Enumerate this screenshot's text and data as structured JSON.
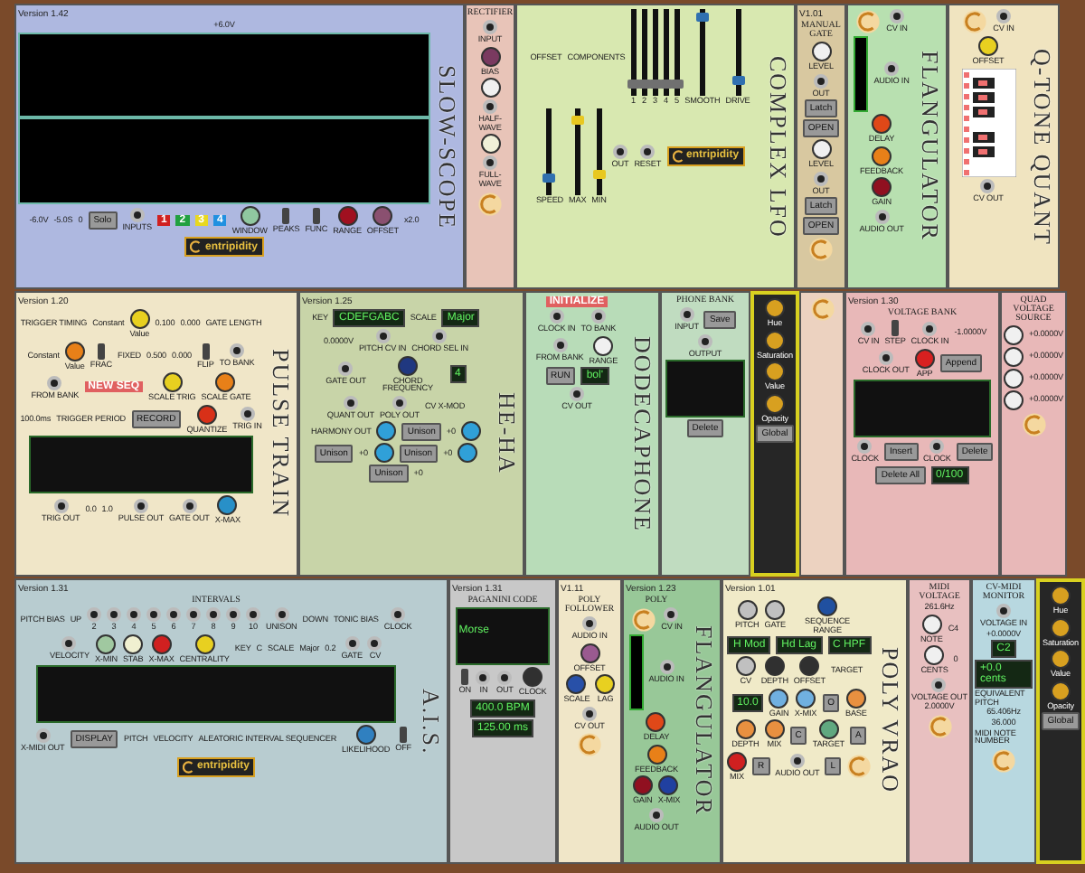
{
  "racks": [
    {
      "modules": [
        {
          "color": "#aeb8e0",
          "version": "Version 1.42",
          "side_title": "SLOW-SCOPE",
          "controls": [
            {
              "kind": "text",
              "label": "+6.0V"
            },
            {
              "kind": "scope_screen"
            },
            {
              "kind": "text",
              "label": "-6.0V"
            },
            {
              "kind": "text",
              "label": "-5.0S"
            },
            {
              "kind": "text",
              "label": "0"
            },
            {
              "kind": "button",
              "label": "Solo"
            },
            {
              "kind": "jack",
              "label": "INPUTS"
            },
            {
              "kind": "tag",
              "label": "1",
              "color": "#d02020"
            },
            {
              "kind": "tag",
              "label": "2",
              "color": "#20a040"
            },
            {
              "kind": "tag",
              "label": "3",
              "color": "#e8d820"
            },
            {
              "kind": "tag",
              "label": "4",
              "color": "#2090e0"
            },
            {
              "kind": "knob",
              "label": "WINDOW",
              "color": "#90c8a0"
            },
            {
              "kind": "switch",
              "label": "PEAKS"
            },
            {
              "kind": "switch",
              "label": "FUNC"
            },
            {
              "kind": "knob",
              "label": "RANGE",
              "color": "#a01020"
            },
            {
              "kind": "knob",
              "label": "OFFSET",
              "color": "#8a5070"
            },
            {
              "kind": "text",
              "label": "x2.0"
            },
            {
              "kind": "logo",
              "label": "entripidity"
            }
          ]
        },
        {
          "color": "#e8c4b8",
          "title": "RECTIFIER",
          "controls": [
            {
              "kind": "jack",
              "label": "INPUT"
            },
            {
              "kind": "knob",
              "label": "BIAS",
              "color": "#7a3a60"
            },
            {
              "kind": "knob",
              "color": "#f0f0f0"
            },
            {
              "kind": "jack",
              "label": "HALF-WAVE"
            },
            {
              "kind": "knob",
              "color": "#f0f0d8"
            },
            {
              "kind": "jack",
              "label": "FULL-WAVE"
            },
            {
              "kind": "clogo"
            }
          ]
        },
        {
          "color": "#d8e8b0",
          "side_title": "COMPLEX LFO",
          "controls": [
            {
              "kind": "text",
              "label": "OFFSET"
            },
            {
              "kind": "text",
              "label": "COMPONENTS"
            },
            {
              "kind": "slider",
              "label": "1",
              "level": 0.1,
              "color": "#707070"
            },
            {
              "kind": "slider",
              "label": "2",
              "level": 0.1,
              "color": "#707070"
            },
            {
              "kind": "slider",
              "label": "3",
              "level": 0.1,
              "color": "#707070"
            },
            {
              "kind": "slider",
              "label": "4",
              "level": 0.1,
              "color": "#707070"
            },
            {
              "kind": "slider",
              "label": "5",
              "level": 0.1,
              "color": "#707070"
            },
            {
              "kind": "slider",
              "label": "SMOOTH",
              "level": 0.95,
              "color": "#3070b0"
            },
            {
              "kind": "slider",
              "label": "DRIVE",
              "level": 0.15,
              "color": "#3070b0"
            },
            {
              "kind": "slider",
              "label": "SPEED",
              "level": 0.15,
              "color": "#3070b0"
            },
            {
              "kind": "slider",
              "label": "MAX",
              "level": 0.9,
              "color": "#e8c820"
            },
            {
              "kind": "slider",
              "label": "MIN",
              "level": 0.2,
              "color": "#e8c820"
            },
            {
              "kind": "jack",
              "label": "OUT"
            },
            {
              "kind": "jack",
              "label": "RESET"
            },
            {
              "kind": "logo",
              "label": "entripidity"
            }
          ]
        },
        {
          "color": "#d8c8a0",
          "title": "MANUAL GATE",
          "version": "V1.01",
          "controls": [
            {
              "kind": "knob",
              "label": "LEVEL",
              "color": "#f0f0f0"
            },
            {
              "kind": "jack",
              "label": "OUT"
            },
            {
              "kind": "button",
              "label": "Latch"
            },
            {
              "kind": "button",
              "label": "OPEN"
            },
            {
              "kind": "knob",
              "label": "LEVEL",
              "color": "#f0f0f0"
            },
            {
              "kind": "jack",
              "label": "OUT"
            },
            {
              "kind": "button",
              "label": "Latch"
            },
            {
              "kind": "button",
              "label": "OPEN"
            },
            {
              "kind": "clogo"
            }
          ]
        },
        {
          "color": "#b8e0b0",
          "side_title": "FLANGULATOR",
          "controls": [
            {
              "kind": "clogo"
            },
            {
              "kind": "jack",
              "label": "CV IN"
            },
            {
              "kind": "meter"
            },
            {
              "kind": "jack",
              "label": "AUDIO IN"
            },
            {
              "kind": "knob",
              "label": "DELAY",
              "color": "#e04818"
            },
            {
              "kind": "knob",
              "label": "FEEDBACK",
              "color": "#e88018"
            },
            {
              "kind": "knob",
              "label": "GAIN",
              "color": "#901020"
            },
            {
              "kind": "jack",
              "label": "AUDIO OUT"
            }
          ]
        },
        {
          "color": "#f0e4c0",
          "side_title": "Q-TONE QUANT",
          "controls": [
            {
              "kind": "clogo"
            },
            {
              "kind": "jack",
              "label": "CV IN"
            },
            {
              "kind": "knob",
              "label": "OFFSET",
              "color": "#e8d020"
            },
            {
              "kind": "keyboard"
            },
            {
              "kind": "jack",
              "label": "CV OUT"
            }
          ]
        }
      ]
    },
    {
      "modules": [
        {
          "color": "#f0e6c8",
          "version": "Version 1.20",
          "side_title": "PULSE TRAIN",
          "controls": [
            {
              "kind": "text",
              "label": "TRIGGER TIMING"
            },
            {
              "kind": "text",
              "label": "Constant"
            },
            {
              "kind": "knob",
              "label": "Value",
              "color": "#e8d020"
            },
            {
              "kind": "text",
              "label": "0.100"
            },
            {
              "kind": "text",
              "label": "0.000"
            },
            {
              "kind": "text",
              "label": "GATE LENGTH"
            },
            {
              "kind": "text",
              "label": "Constant"
            },
            {
              "kind": "knob",
              "label": "Value",
              "color": "#e88018"
            },
            {
              "kind": "switch",
              "label": "FRAC"
            },
            {
              "kind": "text",
              "label": "FIXED"
            },
            {
              "kind": "text",
              "label": "0.500"
            },
            {
              "kind": "text",
              "label": "0.000"
            },
            {
              "kind": "switch",
              "label": "FLIP"
            },
            {
              "kind": "jack",
              "label": "TO BANK"
            },
            {
              "kind": "jack",
              "label": "FROM BANK"
            },
            {
              "kind": "tag",
              "label": "NEW SEQ",
              "color": "#e06060"
            },
            {
              "kind": "knob",
              "label": "SCALE TRIG",
              "color": "#e8d020"
            },
            {
              "kind": "knob",
              "label": "SCALE GATE",
              "color": "#e88018"
            },
            {
              "kind": "text",
              "label": "100.0ms"
            },
            {
              "kind": "text",
              "label": "TRIGGER PERIOD"
            },
            {
              "kind": "button",
              "label": "RECORD"
            },
            {
              "kind": "knob",
              "label": "QUANTIZE",
              "color": "#d83018"
            },
            {
              "kind": "jack",
              "label": "TRIG IN"
            },
            {
              "kind": "screen"
            },
            {
              "kind": "jack",
              "label": "TRIG OUT"
            },
            {
              "kind": "text",
              "label": "0.0"
            },
            {
              "kind": "text",
              "label": "1.0"
            },
            {
              "kind": "jack",
              "label": "PULSE OUT"
            },
            {
              "kind": "jack",
              "label": "GATE OUT"
            },
            {
              "kind": "knob",
              "label": "X-MAX",
              "color": "#2890c8"
            }
          ]
        },
        {
          "color": "#c8d4a8",
          "version": "Version 1.25",
          "side_title": "HE-HA",
          "controls": [
            {
              "kind": "text",
              "label": "KEY"
            },
            {
              "kind": "lcd",
              "label": "CDEFGABC"
            },
            {
              "kind": "text",
              "label": "SCALE"
            },
            {
              "kind": "lcd",
              "label": "Major"
            },
            {
              "kind": "text",
              "label": "0.0000V"
            },
            {
              "kind": "jack",
              "label": "PITCH CV IN"
            },
            {
              "kind": "jack",
              "label": "CHORD SEL IN"
            },
            {
              "kind": "jack",
              "label": "GATE OUT"
            },
            {
              "kind": "knob",
              "label": "CHORD FREQUENCY",
              "color": "#203880"
            },
            {
              "kind": "lcd",
              "label": "4"
            },
            {
              "kind": "jack",
              "label": "QUANT OUT"
            },
            {
              "kind": "jack",
              "label": "POLY OUT"
            },
            {
              "kind": "text",
              "label": "CV X-MOD"
            },
            {
              "kind": "text",
              "label": "HARMONY OUT"
            },
            {
              "kind": "knob",
              "color": "#30a0d8"
            },
            {
              "kind": "button",
              "label": "Unison"
            },
            {
              "kind": "text",
              "label": "+0"
            },
            {
              "kind": "knob",
              "color": "#30a0d8"
            },
            {
              "kind": "button",
              "label": "Unison"
            },
            {
              "kind": "text",
              "label": "+0"
            },
            {
              "kind": "knob",
              "color": "#30a0d8"
            },
            {
              "kind": "button",
              "label": "Unison"
            },
            {
              "kind": "text",
              "label": "+0"
            },
            {
              "kind": "knob",
              "color": "#30a0d8"
            },
            {
              "kind": "button",
              "label": "Unison"
            },
            {
              "kind": "text",
              "label": "+0"
            }
          ]
        },
        {
          "color": "#b8dcb8",
          "side_title": "DODECAPHONE",
          "controls": [
            {
              "kind": "tag",
              "label": "INITIALIZE",
              "color": "#e06060"
            },
            {
              "kind": "jack",
              "label": "CLOCK IN"
            },
            {
              "kind": "jack",
              "label": "TO BANK"
            },
            {
              "kind": "jack",
              "label": "FROM BANK"
            },
            {
              "kind": "knob",
              "label": "RANGE",
              "color": "#f0f0f0"
            },
            {
              "kind": "button",
              "label": "RUN"
            },
            {
              "kind": "lcd",
              "label": "bol'"
            },
            {
              "kind": "jack",
              "label": "CV OUT"
            }
          ]
        },
        {
          "color": "#c0dcc0",
          "title": "PHONE BANK",
          "controls": [
            {
              "kind": "jack",
              "label": "INPUT"
            },
            {
              "kind": "button",
              "label": "Save"
            },
            {
              "kind": "jack",
              "label": "OUTPUT"
            },
            {
              "kind": "screen"
            },
            {
              "kind": "button",
              "label": "Delete"
            }
          ]
        },
        {
          "color": "#262626",
          "dark": true,
          "controls": [
            {
              "kind": "knob",
              "label": "Hue",
              "color": "#d8a020"
            },
            {
              "kind": "knob",
              "label": "Saturation",
              "color": "#d8a020"
            },
            {
              "kind": "knob",
              "label": "Value",
              "color": "#d8a020"
            },
            {
              "kind": "knob",
              "label": "Opacity",
              "color": "#d8a020"
            },
            {
              "kind": "button",
              "label": "Global"
            }
          ]
        },
        {
          "color": "#ecd2c0",
          "controls": [
            {
              "kind": "clogo"
            }
          ]
        },
        {
          "color": "#e8b8b8",
          "title": "VOLTAGE BANK",
          "version": "Version 1.30",
          "controls": [
            {
              "kind": "jack",
              "label": "CV IN"
            },
            {
              "kind": "switch",
              "label": "STEP"
            },
            {
              "kind": "jack",
              "label": "CLOCK IN"
            },
            {
              "kind": "text",
              "label": "-1.0000V"
            },
            {
              "kind": "jack",
              "label": "CLOCK OUT"
            },
            {
              "kind": "knob",
              "label": "APP",
              "color": "#d82020"
            },
            {
              "kind": "button",
              "label": "Append"
            },
            {
              "kind": "screen"
            },
            {
              "kind": "jack",
              "label": "CLOCK"
            },
            {
              "kind": "button",
              "label": "Insert"
            },
            {
              "kind": "jack",
              "label": "CLOCK"
            },
            {
              "kind": "button",
              "label": "Delete"
            },
            {
              "kind": "button",
              "label": "Delete All"
            },
            {
              "kind": "lcd",
              "label": "0/100"
            }
          ]
        },
        {
          "color": "#e8b8b8",
          "title": "QUAD VOLTAGE SOURCE",
          "controls": [
            {
              "kind": "knob",
              "color": "#f0f0f0"
            },
            {
              "kind": "text",
              "label": "+0.0000V"
            },
            {
              "kind": "knob",
              "color": "#f0f0f0"
            },
            {
              "kind": "text",
              "label": "+0.0000V"
            },
            {
              "kind": "knob",
              "color": "#f0f0f0"
            },
            {
              "kind": "text",
              "label": "+0.0000V"
            },
            {
              "kind": "knob",
              "color": "#f0f0f0"
            },
            {
              "kind": "text",
              "label": "+0.0000V"
            },
            {
              "kind": "clogo"
            }
          ]
        }
      ]
    },
    {
      "modules": [
        {
          "color": "#b8ccd0",
          "title": "INTERVALS",
          "version": "Version 1.31",
          "side_title": "A.I.S.",
          "controls": [
            {
              "kind": "text",
              "label": "PITCH BIAS"
            },
            {
              "kind": "text",
              "label": "UP"
            },
            {
              "kind": "jack",
              "label": "2"
            },
            {
              "kind": "jack",
              "label": "3"
            },
            {
              "kind": "jack",
              "label": "4"
            },
            {
              "kind": "jack",
              "label": "5"
            },
            {
              "kind": "jack",
              "label": "6"
            },
            {
              "kind": "jack",
              "label": "7"
            },
            {
              "kind": "jack",
              "label": "8"
            },
            {
              "kind": "jack",
              "label": "9"
            },
            {
              "kind": "jack",
              "label": "10"
            },
            {
              "kind": "jack",
              "label": "UNISON"
            },
            {
              "kind": "text",
              "label": "DOWN"
            },
            {
              "kind": "text",
              "label": "TONIC BIAS"
            },
            {
              "kind": "jack",
              "label": "CLOCK"
            },
            {
              "kind": "jack",
              "label": "VELOCITY"
            },
            {
              "kind": "knob",
              "label": "X-MIN",
              "color": "#a0c8a0"
            },
            {
              "kind": "knob",
              "label": "STAB",
              "color": "#f0f0d0"
            },
            {
              "kind": "knob",
              "label": "X-MAX",
              "color": "#d02020"
            },
            {
              "kind": "knob",
              "label": "CENTRALITY",
              "color": "#e8d020"
            },
            {
              "kind": "text",
              "label": "KEY"
            },
            {
              "kind": "text",
              "label": "C"
            },
            {
              "kind": "text",
              "label": "SCALE"
            },
            {
              "kind": "text",
              "label": "Major"
            },
            {
              "kind": "text",
              "label": "0.2"
            },
            {
              "kind": "jack",
              "label": "GATE"
            },
            {
              "kind": "jack",
              "label": "CV"
            },
            {
              "kind": "screen"
            },
            {
              "kind": "jack",
              "label": "X-MIDI OUT"
            },
            {
              "kind": "button",
              "label": "DISPLAY"
            },
            {
              "kind": "text",
              "label": "PITCH"
            },
            {
              "kind": "text",
              "label": "VELOCITY"
            },
            {
              "kind": "text",
              "label": "ALEATORIC INTERVAL SEQUENCER"
            },
            {
              "kind": "knob",
              "label": "LIKELIHOOD",
              "color": "#3080c0"
            },
            {
              "kind": "switch",
              "label": "OFF"
            },
            {
              "kind": "logo",
              "label": "entripidity"
            }
          ]
        },
        {
          "color": "#c8c8c8",
          "title": "PAGANINI CODE",
          "version": "Version 1.31",
          "controls": [
            {
              "kind": "screen",
              "label": "Morse"
            },
            {
              "kind": "switch",
              "label": "ON"
            },
            {
              "kind": "jack",
              "label": "IN"
            },
            {
              "kind": "jack",
              "label": "OUT"
            },
            {
              "kind": "knob",
              "label": "CLOCK",
              "color": "#303030"
            },
            {
              "kind": "lcd",
              "label": "400.0 BPM"
            },
            {
              "kind": "lcd",
              "label": "125.00 ms"
            }
          ]
        },
        {
          "color": "#f0e6c8",
          "title": "POLY FOLLOWER",
          "version": "V1.11",
          "controls": [
            {
              "kind": "jack",
              "label": "AUDIO IN"
            },
            {
              "kind": "knob",
              "label": "OFFSET",
              "color": "#9a5a90"
            },
            {
              "kind": "knob",
              "label": "SCALE",
              "color": "#2850a8"
            },
            {
              "kind": "knob",
              "label": "LAG",
              "color": "#e8d020"
            },
            {
              "kind": "jack",
              "label": "CV OUT"
            },
            {
              "kind": "clogo"
            }
          ]
        },
        {
          "color": "#98c898",
          "title": "POLY",
          "version": "Version 1.23",
          "side_title": "FLANGULATOR",
          "controls": [
            {
              "kind": "clogo"
            },
            {
              "kind": "jack",
              "label": "CV IN"
            },
            {
              "kind": "meter"
            },
            {
              "kind": "jack",
              "label": "AUDIO IN"
            },
            {
              "kind": "knob",
              "label": "DELAY",
              "color": "#e04818"
            },
            {
              "kind": "knob",
              "label": "FEEDBACK",
              "color": "#e88018"
            },
            {
              "kind": "knob",
              "label": "GAIN",
              "color": "#901020"
            },
            {
              "kind": "knob",
              "label": "X-MIX",
              "color": "#2040a0"
            },
            {
              "kind": "jack",
              "label": "AUDIO OUT"
            }
          ]
        },
        {
          "color": "#f0eac8",
          "version": "Version 1.01",
          "side_title": "POLY VRAO",
          "controls": [
            {
              "kind": "knob",
              "label": "PITCH",
              "color": "#c0c0c0"
            },
            {
              "kind": "knob",
              "label": "GATE",
              "color": "#c0c0c0"
            },
            {
              "kind": "knob",
              "label": "SEQUENCE RANGE",
              "color": "#2050a0"
            },
            {
              "kind": "lcd",
              "label": "H Mod"
            },
            {
              "kind": "lcd",
              "label": "Hd Lag"
            },
            {
              "kind": "lcd",
              "label": "C HPF"
            },
            {
              "kind": "knob",
              "label": "CV",
              "color": "#c0c0c0"
            },
            {
              "kind": "knob",
              "label": "DEPTH",
              "color": "#303030"
            },
            {
              "kind": "knob",
              "label": "OFFSET",
              "color": "#303030"
            },
            {
              "kind": "text",
              "label": "TARGET"
            },
            {
              "kind": "lcd",
              "label": "10.0"
            },
            {
              "kind": "knob",
              "label": "GAIN",
              "color": "#70b0e0"
            },
            {
              "kind": "knob",
              "label": "X-MIX",
              "color": "#70b0e0"
            },
            {
              "kind": "button",
              "label": "O"
            },
            {
              "kind": "knob",
              "label": "BASE",
              "color": "#e89040"
            },
            {
              "kind": "knob",
              "label": "DEPTH",
              "color": "#e89040"
            },
            {
              "kind": "knob",
              "label": "MIX",
              "color": "#e89040"
            },
            {
              "kind": "button",
              "label": "C"
            },
            {
              "kind": "knob",
              "label": "TARGET",
              "color": "#60a880"
            },
            {
              "kind": "button",
              "label": "A"
            },
            {
              "kind": "knob",
              "label": "MIX",
              "color": "#d02020"
            },
            {
              "kind": "button",
              "label": "R"
            },
            {
              "kind": "jack",
              "label": "AUDIO OUT"
            },
            {
              "kind": "button",
              "label": "L"
            },
            {
              "kind": "clogo"
            }
          ]
        },
        {
          "color": "#e8c0c0",
          "title": "MIDI VOLTAGE",
          "controls": [
            {
              "kind": "text",
              "label": "261.6Hz"
            },
            {
              "kind": "knob",
              "label": "NOTE",
              "color": "#f0f0f0"
            },
            {
              "kind": "text",
              "label": "C4"
            },
            {
              "kind": "knob",
              "label": "CENTS",
              "color": "#f0f0f0"
            },
            {
              "kind": "text",
              "label": "0"
            },
            {
              "kind": "jack",
              "label": "VOLTAGE OUT"
            },
            {
              "kind": "text",
              "label": "2.0000V"
            },
            {
              "kind": "clogo"
            }
          ]
        },
        {
          "color": "#b8d8e0",
          "title": "CV-MIDI MONITOR",
          "controls": [
            {
              "kind": "jack",
              "label": "VOLTAGE IN"
            },
            {
              "kind": "text",
              "label": "+0.0000V"
            },
            {
              "kind": "lcd",
              "label": "C2"
            },
            {
              "kind": "lcd",
              "label": "+0.0 cents"
            },
            {
              "kind": "text",
              "label": "EQUIVALENT PITCH"
            },
            {
              "kind": "text",
              "label": "65.406Hz"
            },
            {
              "kind": "text",
              "label": "36.000"
            },
            {
              "kind": "text",
              "label": "MIDI NOTE NUMBER"
            },
            {
              "kind": "clogo"
            }
          ]
        },
        {
          "color": "#262626",
          "dark": true,
          "controls": [
            {
              "kind": "knob",
              "label": "Hue",
              "color": "#d8a020"
            },
            {
              "kind": "knob",
              "label": "Saturation",
              "color": "#d8a020"
            },
            {
              "kind": "knob",
              "label": "Value",
              "color": "#d8a020"
            },
            {
              "kind": "knob",
              "label": "Opacity",
              "color": "#d8a020"
            },
            {
              "kind": "button",
              "label": "Global"
            }
          ]
        }
      ]
    }
  ]
}
